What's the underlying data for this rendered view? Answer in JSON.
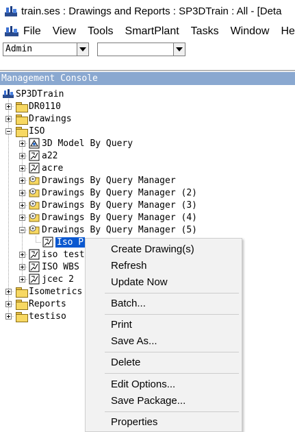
{
  "window": {
    "title": "train.ses : Drawings and Reports : SP3DTrain : All - [Deta"
  },
  "menu": {
    "items": [
      "File",
      "View",
      "Tools",
      "SmartPlant",
      "Tasks",
      "Window",
      "Help"
    ]
  },
  "toolbar": {
    "role_value": "Admin",
    "filter_value": ""
  },
  "panel": {
    "title": "Management Console"
  },
  "tree": {
    "root": "SP3DTrain",
    "nodes": [
      "DR0110",
      "Drawings",
      "ISO",
      "3D Model By Query",
      "a22",
      "acre",
      "Drawings By Query Manager",
      "Drawings By Query Manager (2)",
      "Drawings By Query Manager (3)",
      "Drawings By Query Manager (4)",
      "Drawings By Query Manager (5)",
      "Iso P",
      "iso test",
      "ISO WBS",
      "jcec 2",
      "Isometrics",
      "Reports",
      "testiso"
    ]
  },
  "context_menu": {
    "items": [
      "Create Drawing(s)",
      "Refresh",
      "Update Now",
      "Batch...",
      "Print",
      "Save As...",
      "Delete",
      "Edit Options...",
      "Save Package...",
      "Properties"
    ]
  },
  "colors": {
    "panel_header": "#8aa8d0",
    "selection": "#0a58d0",
    "folder": "#f7d862"
  },
  "icons": {
    "app": "sp3d-app-icon",
    "folder": "folder-icon",
    "drawing": "drawing-icon",
    "query": "query-icon"
  }
}
